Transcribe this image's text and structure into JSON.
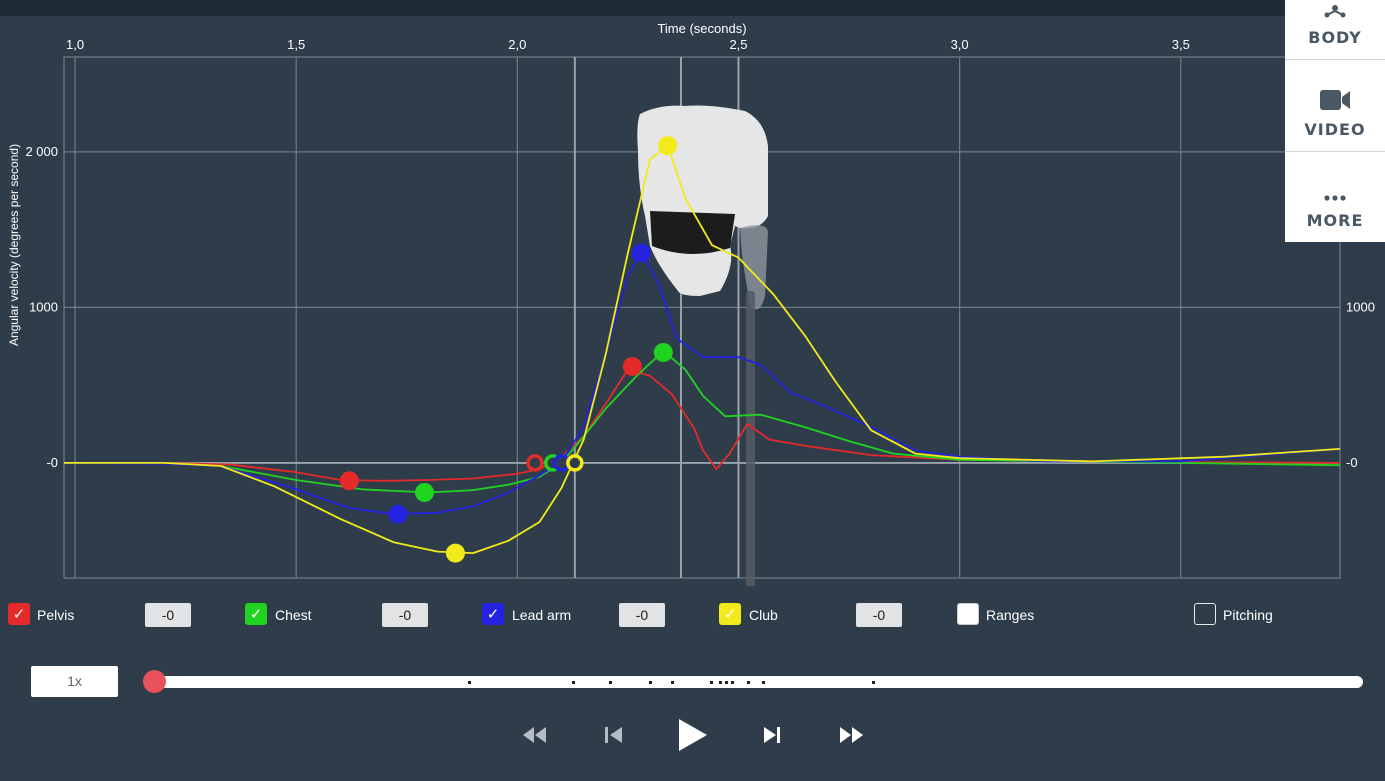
{
  "side_menu": {
    "body_label": "BODY",
    "video_label": "VIDEO",
    "more_label": "MORE"
  },
  "chart_data": {
    "type": "line",
    "xlabel": "Time (seconds)",
    "ylabel": "Angular velocity (degrees per second)",
    "xlim": [
      0.975,
      3.86
    ],
    "ylim": [
      -740,
      2610
    ],
    "x_ticks": [
      {
        "v": 1.0,
        "label": "1,0"
      },
      {
        "v": 1.5,
        "label": "1,5"
      },
      {
        "v": 2.0,
        "label": "2,0"
      },
      {
        "v": 2.5,
        "label": "2,5"
      },
      {
        "v": 3.0,
        "label": "3,0"
      },
      {
        "v": 3.5,
        "label": "3,5"
      }
    ],
    "y_ticks_left": [
      {
        "v": 2000,
        "label": "2 000"
      },
      {
        "v": 1000,
        "label": "1000"
      },
      {
        "v": 0,
        "label": "-0"
      }
    ],
    "y_ticks_right": [
      {
        "v": 1000,
        "label": "1000"
      },
      {
        "v": 0,
        "label": "-0"
      }
    ],
    "marker_lines_x": [
      2.13,
      2.37,
      2.5
    ],
    "grid": true,
    "series": [
      {
        "name": "Pelvis",
        "color": "#e52a2a",
        "points": [
          [
            0.975,
            0
          ],
          [
            1.2,
            0
          ],
          [
            1.35,
            -10
          ],
          [
            1.5,
            -60
          ],
          [
            1.6,
            -110
          ],
          [
            1.7,
            -115
          ],
          [
            1.8,
            -110
          ],
          [
            1.9,
            -100
          ],
          [
            2.0,
            -70
          ],
          [
            2.05,
            -40
          ],
          [
            2.1,
            40
          ],
          [
            2.15,
            170
          ],
          [
            2.2,
            380
          ],
          [
            2.25,
            600
          ],
          [
            2.3,
            560
          ],
          [
            2.35,
            440
          ],
          [
            2.4,
            220
          ],
          [
            2.42,
            80
          ],
          [
            2.45,
            -40
          ],
          [
            2.48,
            60
          ],
          [
            2.52,
            250
          ],
          [
            2.57,
            150
          ],
          [
            2.65,
            110
          ],
          [
            2.8,
            50
          ],
          [
            3.0,
            20
          ],
          [
            3.5,
            5
          ],
          [
            3.86,
            0
          ]
        ],
        "markers": [
          [
            1.62,
            -115
          ],
          [
            2.26,
            620
          ]
        ],
        "start_ring": [
          2.04,
          0
        ]
      },
      {
        "name": "Chest",
        "color": "#21d321",
        "points": [
          [
            0.975,
            0
          ],
          [
            1.2,
            0
          ],
          [
            1.33,
            -20
          ],
          [
            1.5,
            -110
          ],
          [
            1.65,
            -170
          ],
          [
            1.8,
            -190
          ],
          [
            1.9,
            -175
          ],
          [
            1.98,
            -140
          ],
          [
            2.05,
            -90
          ],
          [
            2.1,
            0
          ],
          [
            2.15,
            170
          ],
          [
            2.2,
            350
          ],
          [
            2.27,
            560
          ],
          [
            2.33,
            720
          ],
          [
            2.38,
            600
          ],
          [
            2.42,
            430
          ],
          [
            2.47,
            300
          ],
          [
            2.55,
            310
          ],
          [
            2.65,
            230
          ],
          [
            2.75,
            140
          ],
          [
            2.85,
            60
          ],
          [
            3.0,
            20
          ],
          [
            3.5,
            0
          ],
          [
            3.86,
            -15
          ]
        ],
        "markers": [
          [
            1.79,
            -190
          ],
          [
            2.33,
            710
          ]
        ],
        "start_ring": [
          2.08,
          0
        ]
      },
      {
        "name": "Lead arm",
        "color": "#2222e0",
        "points": [
          [
            0.975,
            0
          ],
          [
            1.2,
            -5
          ],
          [
            1.33,
            -20
          ],
          [
            1.5,
            -170
          ],
          [
            1.62,
            -290
          ],
          [
            1.72,
            -330
          ],
          [
            1.82,
            -320
          ],
          [
            1.9,
            -280
          ],
          [
            1.98,
            -190
          ],
          [
            2.05,
            -80
          ],
          [
            2.1,
            10
          ],
          [
            2.15,
            230
          ],
          [
            2.2,
            700
          ],
          [
            2.25,
            1200
          ],
          [
            2.28,
            1360
          ],
          [
            2.32,
            1150
          ],
          [
            2.36,
            800
          ],
          [
            2.42,
            680
          ],
          [
            2.5,
            680
          ],
          [
            2.55,
            630
          ],
          [
            2.62,
            450
          ],
          [
            2.7,
            360
          ],
          [
            2.8,
            230
          ],
          [
            2.9,
            80
          ],
          [
            3.0,
            40
          ],
          [
            3.2,
            10
          ],
          [
            3.5,
            10
          ],
          [
            3.86,
            90
          ]
        ],
        "markers": [
          [
            1.73,
            -330
          ],
          [
            2.28,
            1350
          ]
        ],
        "start_ring": [
          2.1,
          0
        ]
      },
      {
        "name": "Club",
        "color": "#f2ea1a",
        "points": [
          [
            0.975,
            0
          ],
          [
            1.2,
            0
          ],
          [
            1.33,
            -20
          ],
          [
            1.45,
            -150
          ],
          [
            1.6,
            -360
          ],
          [
            1.72,
            -510
          ],
          [
            1.82,
            -570
          ],
          [
            1.9,
            -580
          ],
          [
            1.98,
            -500
          ],
          [
            2.05,
            -380
          ],
          [
            2.1,
            -160
          ],
          [
            2.15,
            150
          ],
          [
            2.2,
            700
          ],
          [
            2.25,
            1350
          ],
          [
            2.3,
            1950
          ],
          [
            2.34,
            2040
          ],
          [
            2.38,
            1700
          ],
          [
            2.44,
            1400
          ],
          [
            2.5,
            1320
          ],
          [
            2.58,
            1080
          ],
          [
            2.65,
            820
          ],
          [
            2.72,
            520
          ],
          [
            2.8,
            210
          ],
          [
            2.9,
            60
          ],
          [
            3.0,
            30
          ],
          [
            3.3,
            10
          ],
          [
            3.6,
            40
          ],
          [
            3.86,
            90
          ]
        ],
        "markers": [
          [
            1.86,
            -580
          ],
          [
            2.34,
            2040
          ]
        ],
        "start_ring": [
          2.13,
          0
        ]
      }
    ]
  },
  "legend": {
    "pelvis": {
      "label": "Pelvis",
      "value": "-0",
      "color": "#e52a2a"
    },
    "chest": {
      "label": "Chest",
      "value": "-0",
      "color": "#21d321"
    },
    "lead_arm": {
      "label": "Lead arm",
      "value": "-0",
      "color": "#2222e0"
    },
    "club": {
      "label": "Club",
      "value": "-0",
      "color": "#f2ea1a"
    },
    "ranges": {
      "label": "Ranges"
    },
    "pitching": {
      "label": "Pitching"
    }
  },
  "playback": {
    "speed": "1x",
    "timeline_position": 0,
    "event_ticks": [
      0.26,
      0.346,
      0.377,
      0.41,
      0.428,
      0.46,
      0.468,
      0.473,
      0.478,
      0.491,
      0.503,
      0.594
    ]
  }
}
